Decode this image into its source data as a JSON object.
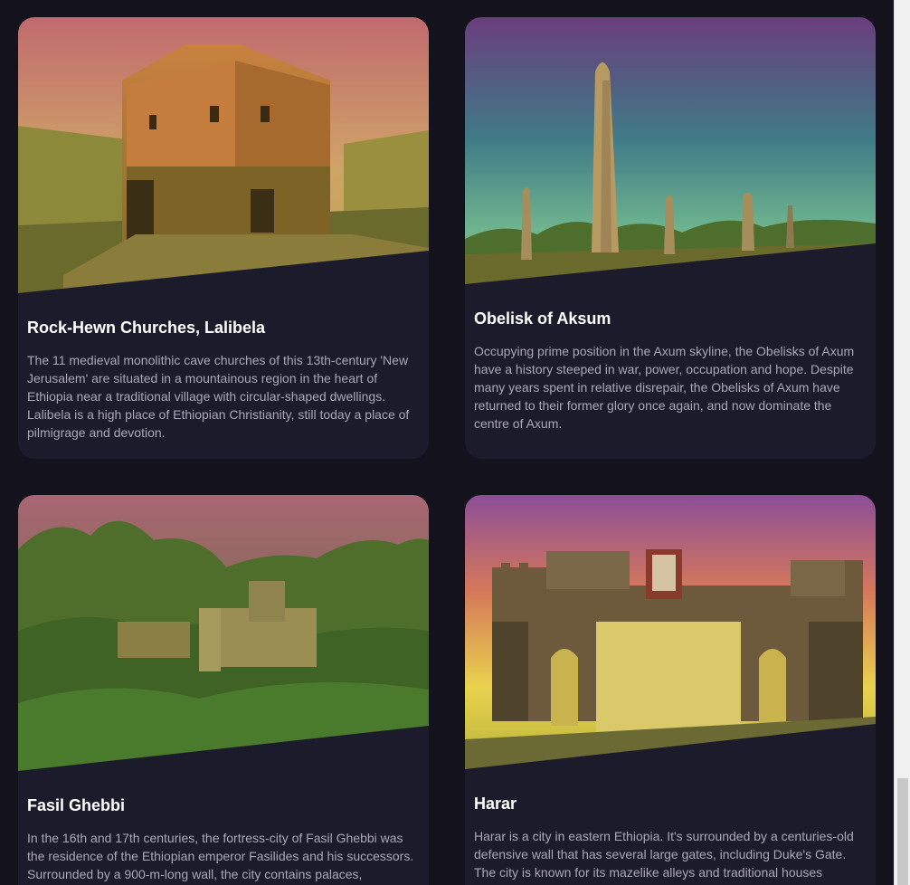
{
  "cards": [
    {
      "title": "Rock-Hewn Churches, Lalibela",
      "description": "The 11 medieval monolithic cave churches of this 13th-century 'New Jerusalem' are situated in a mountainous region in the heart of Ethiopia near a traditional village with circular-shaped dwellings. Lalibela is a high place of Ethiopian Christianity, still today a place of pilmigrage and devotion.",
      "image_subject": "rock-hewn church"
    },
    {
      "title": "Obelisk of Aksum",
      "description": "Occupying prime position in the Axum skyline, the Obelisks of Axum have a history steeped in war, power, occupation and hope. Despite many years spent in relative disrepair, the Obelisks of Axum have returned to their former glory once again, and now dominate the centre of Axum.",
      "image_subject": "obelisk"
    },
    {
      "title": "Fasil Ghebbi",
      "description": "In the 16th and 17th centuries, the fortress-city of Fasil Ghebbi was the residence of the Ethiopian emperor Fasilides and his successors. Surrounded by a 900-m-long wall, the city contains palaces,",
      "image_subject": "castle in forest"
    },
    {
      "title": "Harar",
      "description": "Harar is a city in eastern Ethiopia. It's surrounded by a centuries-old defensive wall that has several large gates, including Duke's Gate. The city is known for its mazelike alleys and traditional houses",
      "image_subject": "city gate"
    }
  ],
  "colors": {
    "page_background": "#13121d",
    "card_background": "#1c1b2b",
    "title": "#ffffff",
    "text": "#a8a6b8"
  }
}
